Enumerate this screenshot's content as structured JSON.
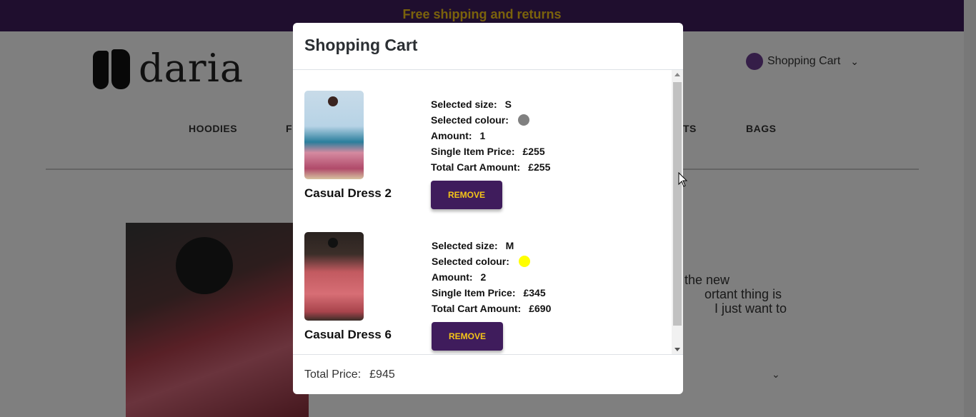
{
  "background": {
    "promo_text": "Free shipping and returns",
    "logo_text": "daria",
    "header_cart_label": "Shopping Cart",
    "nav": [
      "HOODIES",
      "F",
      "TS",
      "BAGS"
    ],
    "description_fragment": [
      "the new",
      "ortant thing is",
      "I just want to"
    ]
  },
  "modal": {
    "title": "Shopping Cart",
    "items": [
      {
        "name": "Casual Dress 2",
        "size_label": "Selected size:",
        "size": "S",
        "colour_label": "Selected colour:",
        "colour": "#808080",
        "amount_label": "Amount:",
        "amount": "1",
        "price_label": "Single Item Price:",
        "price": "£255",
        "total_label": "Total Cart Amount:",
        "total": "£255",
        "remove_label": "REMOVE"
      },
      {
        "name": "Casual Dress 6",
        "size_label": "Selected size:",
        "size": "M",
        "colour_label": "Selected colour:",
        "colour": "#ffff00",
        "amount_label": "Amount:",
        "amount": "2",
        "price_label": "Single Item Price:",
        "price": "£345",
        "total_label": "Total Cart Amount:",
        "total": "£690",
        "remove_label": "REMOVE"
      }
    ],
    "footer": {
      "total_label": "Total Price:",
      "total_value": "£945"
    }
  },
  "colors": {
    "brand_purple": "#3f1c5c",
    "accent_yellow": "#f5c518"
  }
}
